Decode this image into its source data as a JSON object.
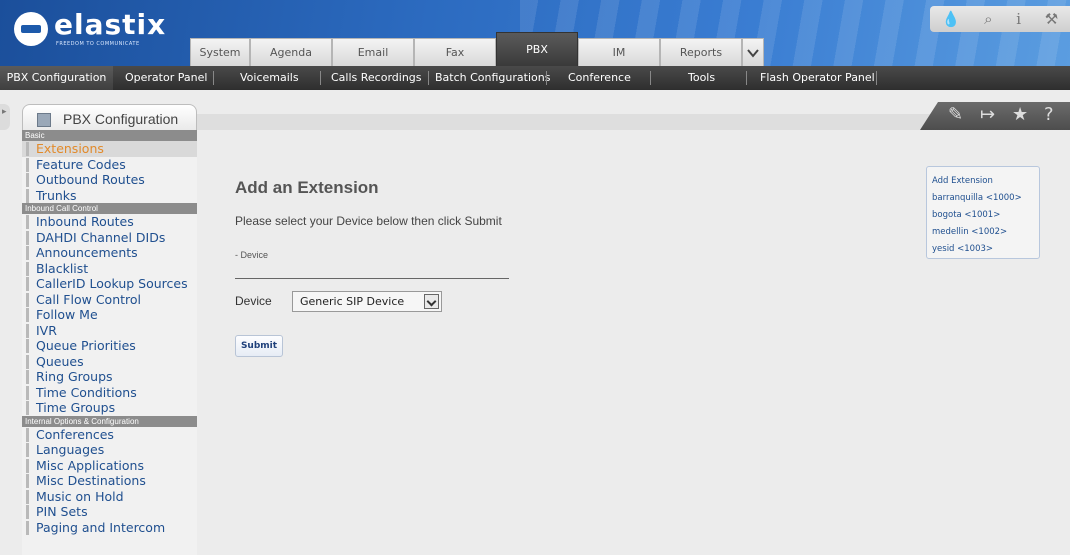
{
  "header": {
    "logo_text": "elastix",
    "logo_tagline": "FREEDOM TO COMMUNICATE",
    "tabs": [
      {
        "label": "System"
      },
      {
        "label": "Agenda"
      },
      {
        "label": "Email"
      },
      {
        "label": "Fax"
      },
      {
        "label": "PBX"
      },
      {
        "label": "IM"
      },
      {
        "label": "Reports"
      }
    ],
    "active_tab": "PBX",
    "icons": [
      "drop-icon",
      "search-icon",
      "info-icon",
      "tools-icon"
    ]
  },
  "menubar": {
    "items": [
      {
        "label": "PBX Configuration"
      },
      {
        "label": "Operator Panel"
      },
      {
        "label": "Voicemails"
      },
      {
        "label": "Calls Recordings"
      },
      {
        "label": "Batch Configurations"
      },
      {
        "label": "Conference"
      },
      {
        "label": "Tools"
      },
      {
        "label": "Flash Operator Panel"
      }
    ]
  },
  "breadcrumb": {
    "title": "PBX Configuration"
  },
  "sidebar": {
    "sections": [
      {
        "label": "Basic",
        "items": [
          "Extensions",
          "Feature Codes",
          "Outbound Routes",
          "Trunks"
        ]
      },
      {
        "label": "Inbound Call Control",
        "items": [
          "Inbound Routes",
          "DAHDI Channel DIDs",
          "Announcements",
          "Blacklist",
          "CallerID Lookup Sources",
          "Call Flow Control",
          "Follow Me",
          "IVR",
          "Queue Priorities",
          "Queues",
          "Ring Groups",
          "Time Conditions",
          "Time Groups"
        ]
      },
      {
        "label": "Internal Options & Configuration",
        "items": [
          "Conferences",
          "Languages",
          "Misc Applications",
          "Misc Destinations",
          "Music on Hold",
          "PIN Sets",
          "Paging and Intercom"
        ]
      }
    ],
    "active_item": "Extensions"
  },
  "main": {
    "title": "Add an Extension",
    "instruction": "Please select your Device below then click Submit",
    "device_section": "- Device",
    "device_label": "Device",
    "device_value": "Generic SIP Device",
    "submit_label": "Submit"
  },
  "right_panel": {
    "items": [
      "Add Extension",
      "barranquilla <1000>",
      "bogota <1001>",
      "medellin <1002>",
      "yesid <1003>"
    ]
  },
  "colors": {
    "header_blue": "#2c6bc0",
    "menubar": "#3a3a3a",
    "link": "#1f4f8f",
    "active_item": "#e28a2a"
  }
}
